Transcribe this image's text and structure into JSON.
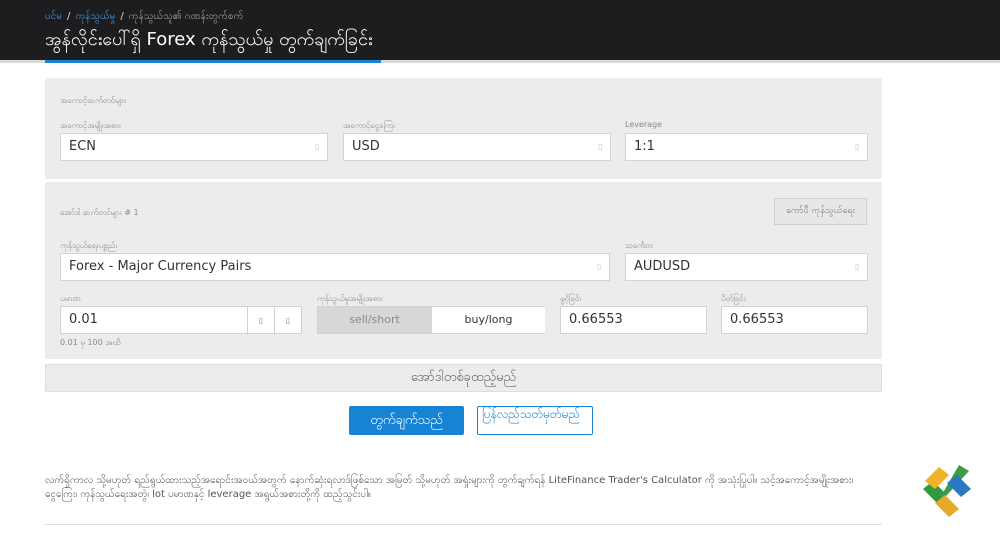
{
  "header": {
    "breadcrumb": [
      "ပင်မ",
      "ကုန်သွယ်မှု",
      "ကုန်သွယ်သူ၏ ဂဏန်းတွက်စက်"
    ],
    "title": "အွန်လိုင်းပေါ်ရှိ Forex ကုန်သွယ်မှု တွက်ချက်ခြင်း"
  },
  "account": {
    "section_label": "အကောင့်ဆက်တင်များ",
    "type_label": "အကောင့်အမျိုးအစား",
    "type_value": "ECN",
    "currency_label": "အကောင့်ငွေကြေး",
    "currency_value": "USD",
    "leverage_label": "Leverage",
    "leverage_value": "1:1"
  },
  "trade": {
    "section_label": "အော်ဒါ ဆက်တင်များ # 1",
    "add_trade_label": "ကော်ပီ ကုန်သွယ်ရေး",
    "instrument_group_label": "ကုန်သွယ်ရေးပစ္စည်း",
    "instrument_group_value": "Forex - Major Currency Pairs",
    "symbol_label": "သင်္ကေတ",
    "symbol_value": "AUDUSD",
    "volume_label": "ပမာဏ",
    "volume_value": "0.01",
    "volume_hint": "0.01 မှ 100 အထိ",
    "direction_label": "ကုန်သွယ်မှုအမျိုးအစား",
    "sell_label": "sell/short",
    "buy_label": "buy/long",
    "open_price_label": "ဖွင့်ခြင်း",
    "open_price_value": "0.66553",
    "close_price_label": "ပိတ်ခြင်း",
    "close_price_value": "0.66553",
    "stepper_down": "▯",
    "stepper_up": "▯",
    "caret": "▯"
  },
  "actions": {
    "add_order": "အော်ဒါတစ်ခုထည့်မည်",
    "calculate": "တွက်ချက်သည်",
    "reset": "ပြန်လည်သတ်မှတ်မည်"
  },
  "description": "လက်ရှိကာလ သို့မဟုတ် ရည်ရွယ်ထားသည့်အရောင်းအဝယ်အတွက် နောက်ဆုံးရလာဒ်ဖြစ်သော အမြတ် သို့မဟုတ် အရှုံးများကို တွက်ချက်ရန် LiteFinance Trader's Calculator ကို အသုံးပြုပါ။ သင့်အကောင့်အမျိုးအစား၊ ငွေကြေး၊ ကုန်သွယ်ရေးအတွဲ၊ lot ပမာဏနှင့် leverage အရွယ်အစားတို့ကို ထည့်သွင်းပါ။",
  "colors": {
    "accent": "#1683d5",
    "header_bg": "#1d1d1f",
    "panel_bg": "#ececec"
  },
  "logo": {
    "icon": "litefinance-logo-icon"
  }
}
